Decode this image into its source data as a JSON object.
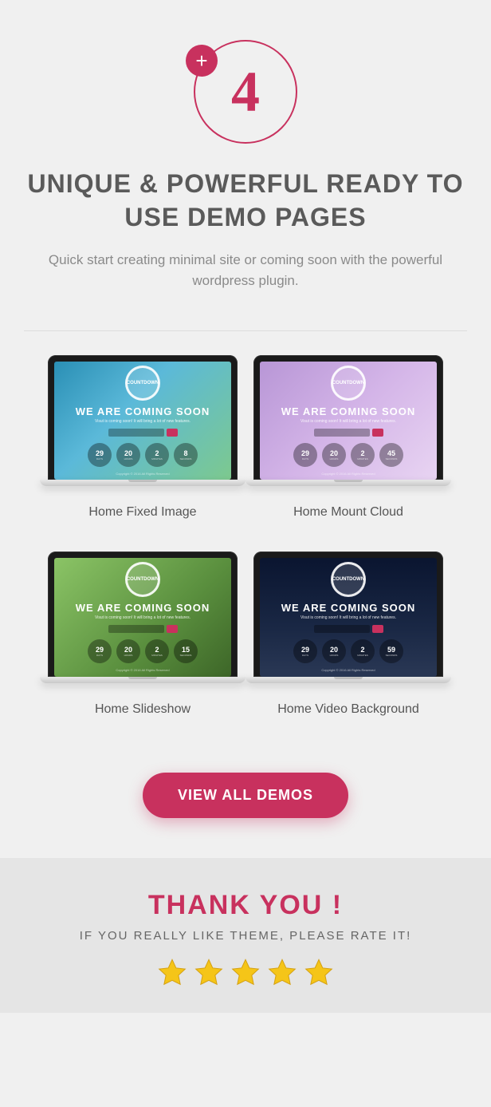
{
  "hero": {
    "number": "4",
    "plus": "+",
    "headline": "UNIQUE & POWERFUL READY TO USE DEMO PAGES",
    "subhead": "Quick start creating minimal site or coming soon with the powerful wordpress plugin."
  },
  "screen": {
    "logo": "COUNTDOWN",
    "title": "WE ARE COMING SOON",
    "subtitle": "Visut is coming soon! It will bring a lot of new features.",
    "copyright": "Copyright © 2016 All Rights Reserved"
  },
  "demos": [
    {
      "label": "Home Fixed Image",
      "bg": "bg-blue",
      "counters": [
        [
          "29",
          "DAYS"
        ],
        [
          "20",
          "HOURS"
        ],
        [
          "2",
          "MINUTES"
        ],
        [
          "8",
          "SECONDS"
        ]
      ]
    },
    {
      "label": "Home Mount Cloud",
      "bg": "bg-purple",
      "counters": [
        [
          "29",
          "DAYS"
        ],
        [
          "20",
          "HOURS"
        ],
        [
          "2",
          "MINUTES"
        ],
        [
          "45",
          "SECONDS"
        ]
      ]
    },
    {
      "label": "Home Slideshow",
      "bg": "bg-green",
      "counters": [
        [
          "29",
          "DAYS"
        ],
        [
          "20",
          "HOURS"
        ],
        [
          "2",
          "MINUTES"
        ],
        [
          "15",
          "SECONDS"
        ]
      ]
    },
    {
      "label": "Home Video Background",
      "bg": "bg-dark",
      "counters": [
        [
          "29",
          "DAYS"
        ],
        [
          "20",
          "HOURS"
        ],
        [
          "2",
          "MINUTES"
        ],
        [
          "59",
          "SECONDS"
        ]
      ]
    }
  ],
  "cta": {
    "label": "VIEW ALL DEMOS"
  },
  "footer": {
    "thanks": "THANK YOU !",
    "rate": "IF YOU REALLY LIKE THEME, PLEASE RATE IT!",
    "stars": 5
  }
}
